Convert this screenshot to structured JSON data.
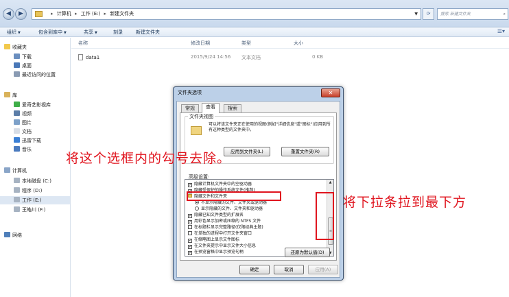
{
  "address": {
    "crumbs": [
      "计算机",
      "工作 (E:)",
      "新建文件夹"
    ],
    "search_placeholder": "搜索 新建文件夹"
  },
  "toolbar": {
    "organize": "组织",
    "include_in_library": "包含到库中",
    "share": "共享",
    "burn": "刻录",
    "new_folder": "新建文件夹"
  },
  "nav": {
    "favorites": "收藏夹",
    "downloads": "下载",
    "desktop": "桌面",
    "recent": "最近访问的位置",
    "libraries": "库",
    "iqiyi": "爱奇艺影视库",
    "videos": "视频",
    "pictures": "图片",
    "documents": "文档",
    "xunlei": "迅雷下载",
    "music": "音乐",
    "computer": "计算机",
    "disk_c": "本地磁盘 (C:)",
    "disk_d": "程序 (D:)",
    "disk_e": "工作 (E:)",
    "disk_f": "王皓川 (F:)",
    "network": "网络"
  },
  "list": {
    "columns": [
      "名称",
      "修改日期",
      "类型",
      "大小"
    ],
    "files": [
      {
        "name": "data1",
        "modified": "2015/9/24 14:56",
        "type": "文本文档",
        "size": "0 KB"
      }
    ]
  },
  "dialog": {
    "title": "文件夹选项",
    "tabs": [
      "常规",
      "查看",
      "搜索"
    ],
    "group_title": "文件夹视图",
    "group_desc": "可以将该文件夹正在使用的视图(例如\"详细信息\"或\"图标\")应用到所有这种类型的文件夹中。",
    "apply_to_folders": "应用到文件夹(L)",
    "reset_folders": "重置文件夹(R)",
    "advanced_label": "高级设置:",
    "settings": [
      {
        "kind": "check",
        "checked": true,
        "indent": 0,
        "label": "隐藏计算机文件夹中的空驱动器"
      },
      {
        "kind": "check",
        "checked": true,
        "indent": 0,
        "label": "隐藏受保护的操作系统文件(推荐)"
      },
      {
        "kind": "folder",
        "indent": 0,
        "label": "隐藏文件和文件夹"
      },
      {
        "kind": "radio",
        "checked": true,
        "indent": 1,
        "label": "不显示隐藏的文件、文件夹或驱动器"
      },
      {
        "kind": "radio",
        "checked": false,
        "indent": 1,
        "label": "显示隐藏的文件、文件夹和驱动器"
      },
      {
        "kind": "check",
        "checked": true,
        "indent": 0,
        "label": "隐藏已知文件类型的扩展名"
      },
      {
        "kind": "check",
        "checked": true,
        "indent": 0,
        "label": "用彩色显示加密或压缩的 NTFS 文件"
      },
      {
        "kind": "check",
        "checked": false,
        "indent": 0,
        "label": "在标题栏显示完整路径(仅限经典主题)"
      },
      {
        "kind": "check",
        "checked": false,
        "indent": 0,
        "label": "在单独的进程中打开文件夹窗口"
      },
      {
        "kind": "check",
        "checked": true,
        "indent": 0,
        "label": "在缩略图上显示文件图标"
      },
      {
        "kind": "check",
        "checked": true,
        "indent": 0,
        "label": "在文件夹提示中显示文件大小信息"
      },
      {
        "kind": "check",
        "checked": true,
        "indent": 0,
        "label": "在预览窗格中显示预览句柄"
      }
    ],
    "restore_defaults": "还原为默认值(D)",
    "ok": "确定",
    "cancel": "取消",
    "apply": "应用(A)"
  },
  "annotations": {
    "note_left": "将这个选框内的勾号去除。",
    "note_right": "将下拉条拉到最下方",
    "color": "#e0141e"
  }
}
